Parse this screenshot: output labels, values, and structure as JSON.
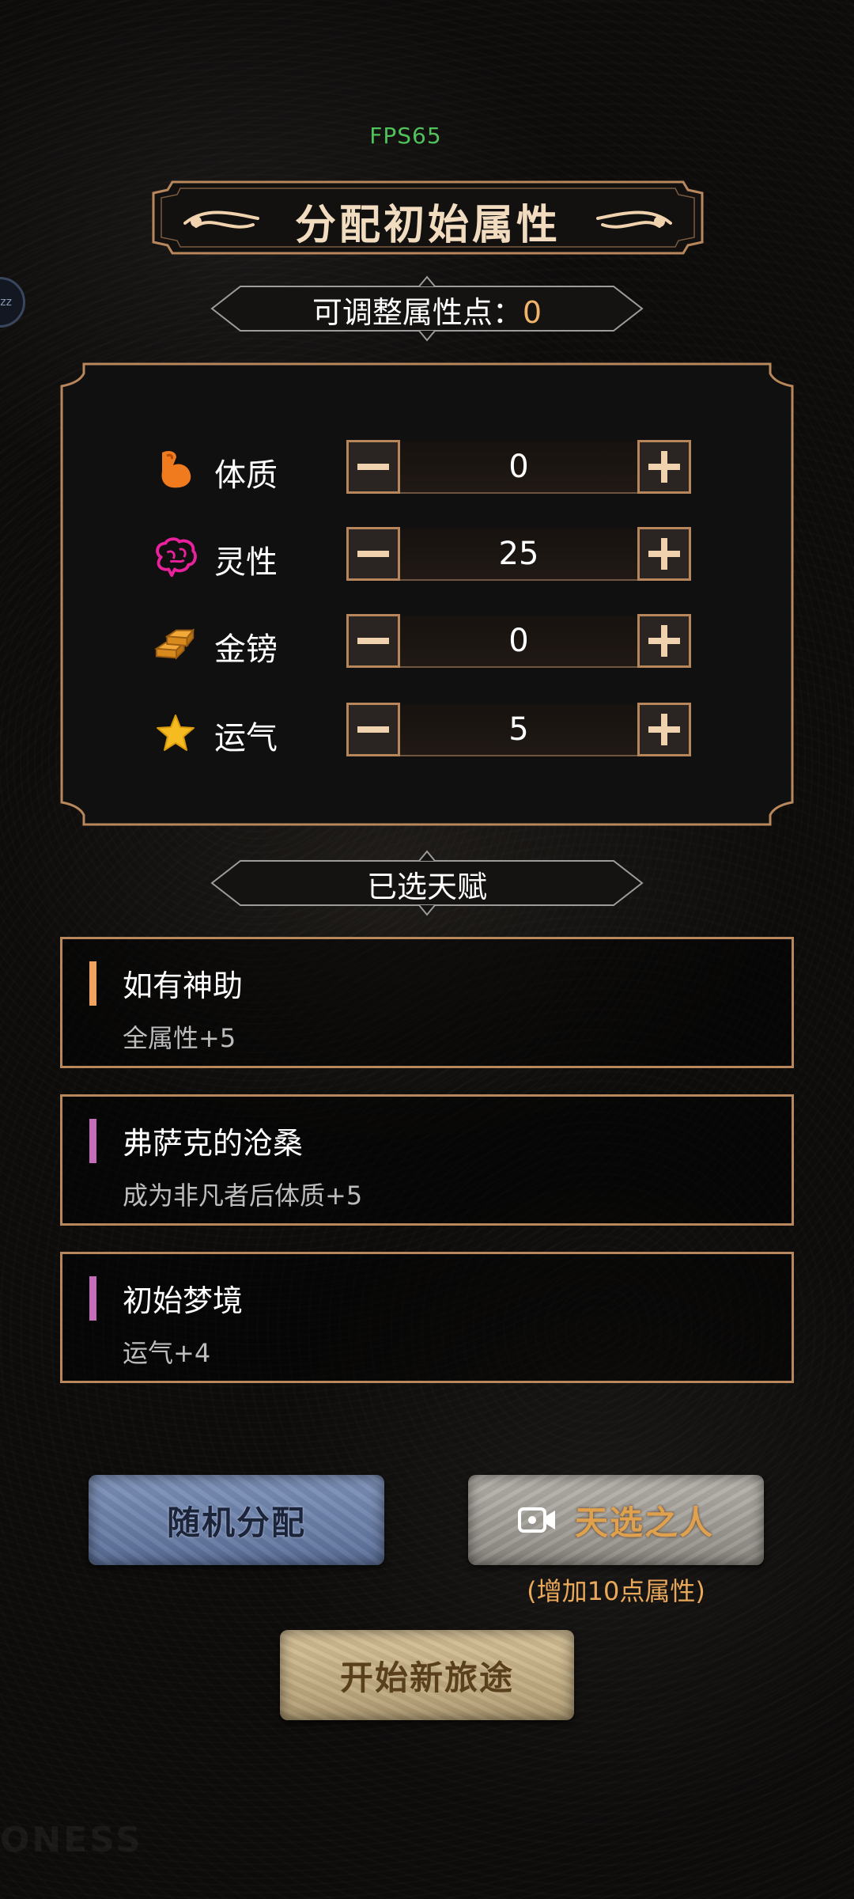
{
  "status": {
    "fps": "FPS65"
  },
  "side_bubble": {
    "text": "zz"
  },
  "title": "分配初始属性",
  "points": {
    "label": "可调整属性点：",
    "value": "0"
  },
  "attributes": [
    {
      "name": "体质",
      "icon": "muscle-arm-icon",
      "value": "0"
    },
    {
      "name": "灵性",
      "icon": "brain-icon",
      "value": "25"
    },
    {
      "name": "金镑",
      "icon": "gold-bars-icon",
      "value": "0"
    },
    {
      "name": "运气",
      "icon": "star-icon",
      "value": "5"
    }
  ],
  "talents_header": "已选天赋",
  "talents": [
    {
      "name": "如有神助",
      "desc": "全属性+5",
      "color": "#f0a35e"
    },
    {
      "name": "弗萨克的沧桑",
      "desc": "成为非凡者后体质+5",
      "color": "#c56dbb"
    },
    {
      "name": "初始梦境",
      "desc": "运气+4",
      "color": "#c56dbb"
    }
  ],
  "buttons": {
    "random": "随机分配",
    "chosen": "天选之人",
    "chosen_note": "(增加10点属性)",
    "start": "开始新旅途"
  },
  "watermark": "ONESS",
  "colors": {
    "accent_orange": "#f2b46a",
    "frame_bronze": "#b8875c",
    "fps_green": "#4fc25a"
  }
}
